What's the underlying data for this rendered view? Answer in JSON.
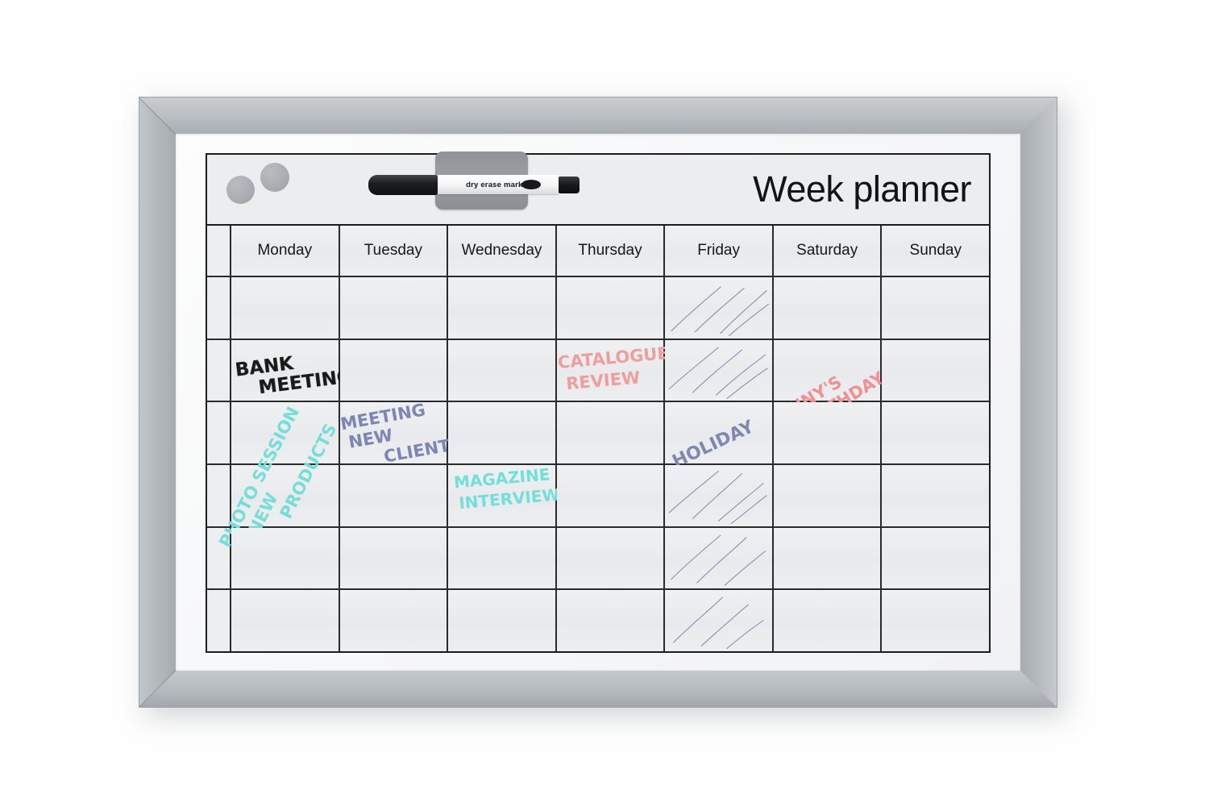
{
  "board": {
    "title": "Week planner",
    "frame_color": "#b6bbbe",
    "surface_color": "#f4f5f6",
    "grid_line_color": "#2a2a2a"
  },
  "accessories": {
    "marker_label": "dry erase marker",
    "marker_cap_color": "#17191b",
    "marker_barrel_color": "#ffffff",
    "holder_color": "#93979b",
    "magnet_color": "#a9adb1",
    "magnet_count": 2
  },
  "days": [
    {
      "label": "Monday"
    },
    {
      "label": "Tuesday"
    },
    {
      "label": "Wednesday"
    },
    {
      "label": "Thursday"
    },
    {
      "label": "Friday"
    },
    {
      "label": "Saturday"
    },
    {
      "label": "Sunday"
    }
  ],
  "notes": {
    "bank_meeting": {
      "line1": "BANK",
      "line2": "MEETING",
      "color": "#1a1a1a",
      "day": "Monday"
    },
    "catalogue_review": {
      "line1": "CATALOGUE",
      "line2": "REVIEW",
      "color": "#ef9f9b",
      "day": "Thursday"
    },
    "jennys_birthday": {
      "line1": "JENNY'S",
      "line2": "BIRTHDAY",
      "color": "#f0918f",
      "day": "Saturday"
    },
    "meeting_new_client": {
      "line1": "MEETING",
      "line2": "NEW",
      "line3": "CLIENT",
      "color": "#7c86b5",
      "day": "Tuesday"
    },
    "holiday": {
      "line1": "HOLIDAY",
      "color": "#7f88b2",
      "day": "Friday"
    },
    "magazine_interview": {
      "line1": "MAGAZINE",
      "line2": "INTERVIEW",
      "color": "#72e0da",
      "day": "Wednesday"
    },
    "photo_session": {
      "line1": "PHOTO SESSION",
      "line2": "NEW",
      "line3": "PRODUCTS",
      "color": "#76ded8",
      "day": "Monday"
    }
  },
  "hatching": {
    "day": "Friday",
    "color": "#8d93ad",
    "description": "diagonal strike-through strokes marking the Friday column as blocked"
  },
  "grid": {
    "content_rows": 6,
    "columns": 7
  }
}
